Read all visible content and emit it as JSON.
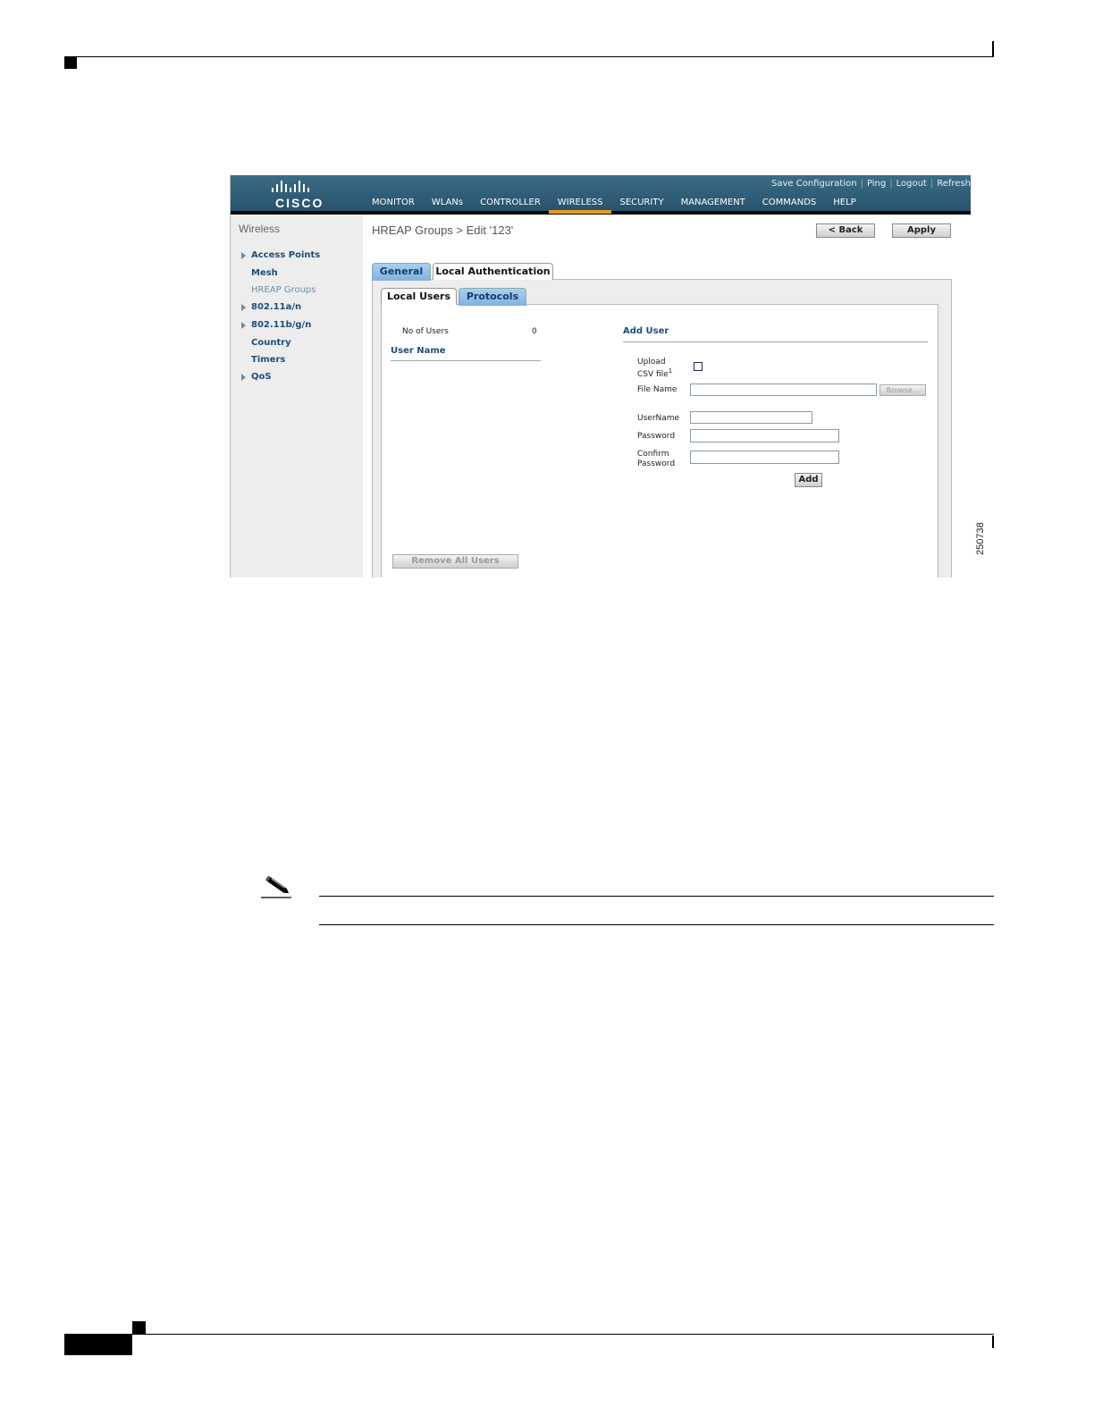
{
  "app": {
    "logo_text": "CISCO",
    "utility_links": [
      "Save Configuration",
      "Ping",
      "Logout",
      "Refresh"
    ],
    "nav": [
      "MONITOR",
      "WLANs",
      "CONTROLLER",
      "WIRELESS",
      "SECURITY",
      "MANAGEMENT",
      "COMMANDS",
      "HELP"
    ],
    "nav_active": "WIRELESS",
    "accent_color": "#e69a23",
    "brand_color": "#25506a"
  },
  "sidebar": {
    "title": "Wireless",
    "items": [
      {
        "label": "Access Points",
        "expandable": true
      },
      {
        "label": "Mesh",
        "expandable": false
      },
      {
        "label": "HREAP Groups",
        "expandable": false,
        "current": true
      },
      {
        "label": "802.11a/n",
        "expandable": true
      },
      {
        "label": "802.11b/g/n",
        "expandable": true
      },
      {
        "label": "Country",
        "expandable": false
      },
      {
        "label": "Timers",
        "expandable": false
      },
      {
        "label": "QoS",
        "expandable": true
      }
    ]
  },
  "page": {
    "title": "HREAP Groups > Edit   '123'",
    "back_button": "< Back",
    "apply_button": "Apply"
  },
  "tabs": [
    "General",
    "Local Authentication"
  ],
  "subtabs": [
    "Local Users",
    "Protocols"
  ],
  "users": {
    "count_label": "No of Users",
    "count_value": "0",
    "column_header": "User Name",
    "remove_all_button": "Remove All Users"
  },
  "add_user": {
    "heading": "Add User",
    "upload_label_1": "Upload",
    "upload_label_2": "CSV file",
    "upload_sup": "1",
    "file_name_label": "File Name",
    "browse_button": "Browse...",
    "username_label": "UserName",
    "password_label": "Password",
    "confirm_label_1": "Confirm",
    "confirm_label_2": "Password",
    "add_button": "Add"
  },
  "figure_number": "250738"
}
